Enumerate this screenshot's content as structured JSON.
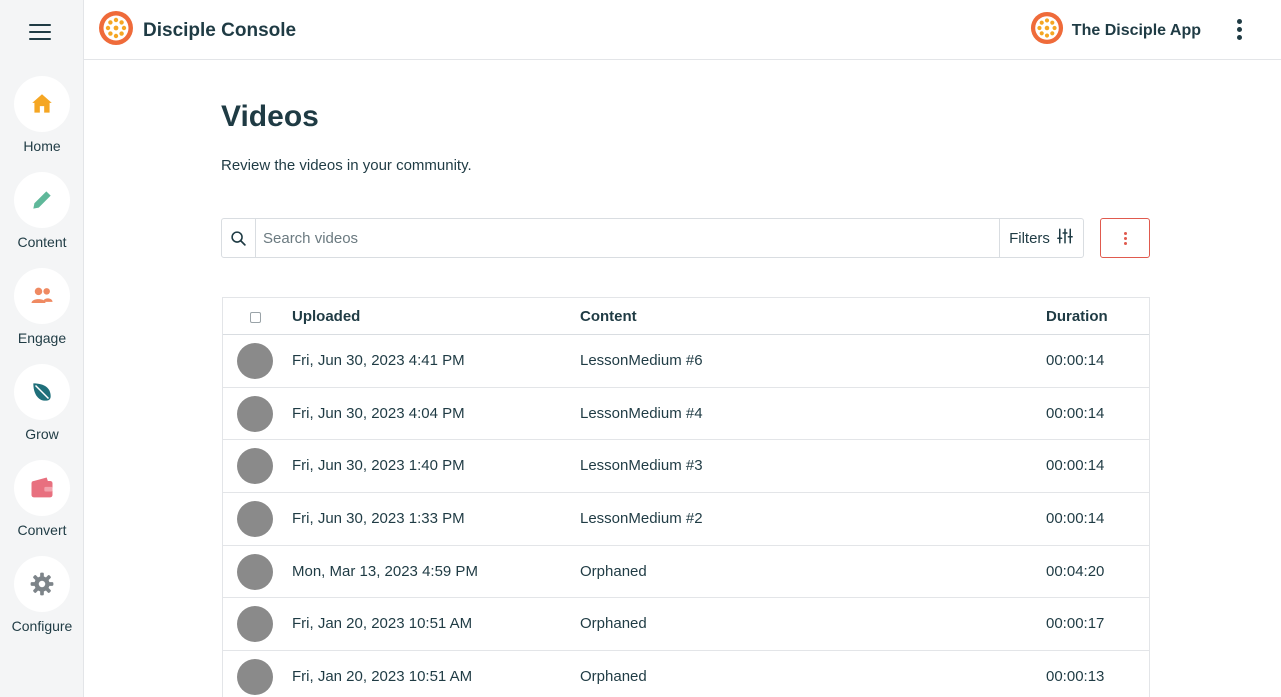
{
  "header": {
    "brand_name": "Disciple Console",
    "app_name": "The Disciple App"
  },
  "sidebar": {
    "items": [
      {
        "label": "Home",
        "icon": "home-icon",
        "color": "#f5a623"
      },
      {
        "label": "Content",
        "icon": "pencil-icon",
        "color": "#5fb89a"
      },
      {
        "label": "Engage",
        "icon": "people-icon",
        "color": "#ef8a62"
      },
      {
        "label": "Grow",
        "icon": "leaf-icon",
        "color": "#1f6f7a"
      },
      {
        "label": "Convert",
        "icon": "wallet-icon",
        "color": "#e8707f"
      },
      {
        "label": "Configure",
        "icon": "gear-icon",
        "color": "#7d8489"
      }
    ]
  },
  "page": {
    "title": "Videos",
    "subtitle": "Review the videos in your community."
  },
  "search": {
    "placeholder": "Search videos",
    "filters_label": "Filters"
  },
  "table": {
    "columns": {
      "uploaded": "Uploaded",
      "content": "Content",
      "duration": "Duration"
    },
    "rows": [
      {
        "uploaded": "Fri, Jun 30, 2023 4:41 PM",
        "content": "LessonMedium #6",
        "duration": "00:00:14"
      },
      {
        "uploaded": "Fri, Jun 30, 2023 4:04 PM",
        "content": "LessonMedium #4",
        "duration": "00:00:14"
      },
      {
        "uploaded": "Fri, Jun 30, 2023 1:40 PM",
        "content": "LessonMedium #3",
        "duration": "00:00:14"
      },
      {
        "uploaded": "Fri, Jun 30, 2023 1:33 PM",
        "content": "LessonMedium #2",
        "duration": "00:00:14"
      },
      {
        "uploaded": "Mon, Mar 13, 2023 4:59 PM",
        "content": "Orphaned",
        "duration": "00:04:20"
      },
      {
        "uploaded": "Fri, Jan 20, 2023 10:51 AM",
        "content": "Orphaned",
        "duration": "00:00:17"
      },
      {
        "uploaded": "Fri, Jan 20, 2023 10:51 AM",
        "content": "Orphaned",
        "duration": "00:00:13"
      }
    ]
  },
  "colors": {
    "accent": "#e05a4e",
    "text": "#1f3b44",
    "logo": "#ef6b3a"
  }
}
